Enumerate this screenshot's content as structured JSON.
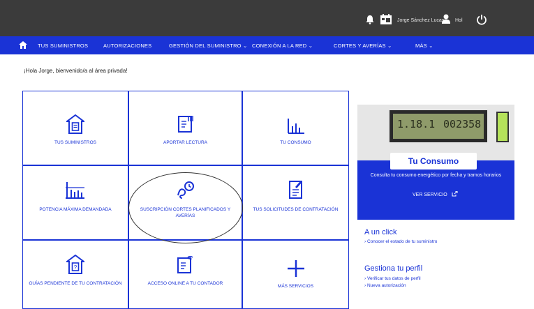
{
  "header": {
    "user_name": "Jorge Sánchez Lucas",
    "user_label": "Hol"
  },
  "nav": {
    "items": [
      "TUS SUMINISTROS",
      "AUTORIZACIONES",
      "GESTIÓN DEL SUMINISTRO ⌄",
      "CONEXIÓN A LA RED ⌄",
      "CORTES Y AVERÍAS ⌄",
      "MÁS ⌄"
    ]
  },
  "greeting": "¡Hola Jorge, bienvenido/a al área privada!",
  "tiles": [
    {
      "label": "TUS SUMINISTROS",
      "icon": "house-document-icon"
    },
    {
      "label": "APORTAR LECTURA",
      "icon": "meter-reading-icon"
    },
    {
      "label": "TU CONSUMO",
      "icon": "bar-chart-icon"
    },
    {
      "label": "POTENCIA MÁXIMA DEMANDADA",
      "icon": "power-chart-icon"
    },
    {
      "label": "SUSCRIPCIÓN CORTES PLANIFICADOS Y AVERÍAS",
      "icon": "subscription-icon"
    },
    {
      "label": "TUS SOLICITUDES DE CONTRATACIÓN",
      "icon": "document-edit-icon"
    },
    {
      "label": "GUÍAS PENDIENTE DE TU CONTRATACIÓN",
      "icon": "house-pending-icon"
    },
    {
      "label": "ACCESO ONLINE A TU CONTADOR",
      "icon": "smart-meter-icon"
    },
    {
      "label": "MÁS SERVICIOS",
      "icon": "plus-icon"
    }
  ],
  "meter_display": {
    "left": "1.18.1",
    "right": "002358"
  },
  "consumo": {
    "title": "Tu Consumo",
    "description": "Consulta tu consumo energético por fecha y tramos horarios",
    "link": "VER SERVICIO"
  },
  "one_click": {
    "title": "A un click",
    "links": [
      "› Conocer el estado de tu suministro"
    ]
  },
  "profile": {
    "title": "Gestiona tu perfil",
    "links": [
      "› Verificar tus datos de perfil",
      "› Nueva autorización"
    ]
  },
  "colors": {
    "brand": "#1a33d6",
    "topbar": "#3b3b3b"
  }
}
